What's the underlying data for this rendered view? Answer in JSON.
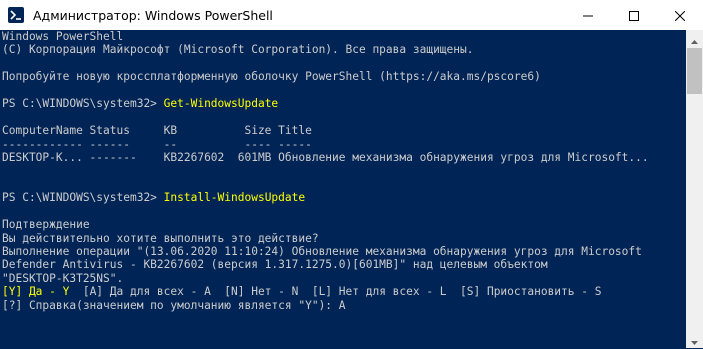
{
  "window": {
    "title": "Администратор: Windows PowerShell",
    "colors": {
      "background": "#012456",
      "text": "#cccccc",
      "command": "#ffff00"
    },
    "icons": {
      "app": "powershell-icon",
      "minimize": "minimize-icon",
      "maximize": "maximize-icon",
      "close": "close-icon"
    }
  },
  "console": {
    "lines": [
      {
        "text": "Windows PowerShell"
      },
      {
        "text": "(C) Корпорация Майкрософт (Microsoft Corporation). Все права защищены."
      },
      {
        "text": ""
      },
      {
        "text": "Попробуйте новую кроссплатформенную оболочку PowerShell (https://aka.ms/pscore6)"
      },
      {
        "text": ""
      },
      {
        "prompt": "PS C:\\WINDOWS\\system32> ",
        "command": "Get-WindowsUpdate"
      },
      {
        "text": ""
      },
      {
        "text": "ComputerName Status     KB          Size Title"
      },
      {
        "text": "------------ ------     --          ---- -----"
      },
      {
        "text": "DESKTOP-K... -------    KB2267602  601MB Обновление механизма обнаружения угроз для Microsoft..."
      },
      {
        "text": ""
      },
      {
        "text": ""
      },
      {
        "prompt": "PS C:\\WINDOWS\\system32> ",
        "command": "Install-WindowsUpdate"
      },
      {
        "text": ""
      },
      {
        "text": "Подтверждение"
      },
      {
        "text": "Вы действительно хотите выполнить это действие?"
      },
      {
        "text": "Выполнение операции \"(13.06.2020 11:10:24) Обновление механизма обнаружения угроз для Microsoft"
      },
      {
        "text": "Defender Antivirus - KB2267602 (версия 1.317.1275.0)[601MB]\" над целевым объектом"
      },
      {
        "text": "\"DESKTOP-K3T25NS\"."
      },
      {
        "choices": [
          {
            "text": "[Y] Да - Y",
            "highlight": true
          },
          {
            "text": "  [A] Да для всех - A  [N] Нет - N  [L] Нет для всех - L  [S] Приостановить - S",
            "highlight": false
          }
        ]
      },
      {
        "text": "[?] Справка(значением по умолчанию является \"Y\"): A"
      }
    ]
  }
}
